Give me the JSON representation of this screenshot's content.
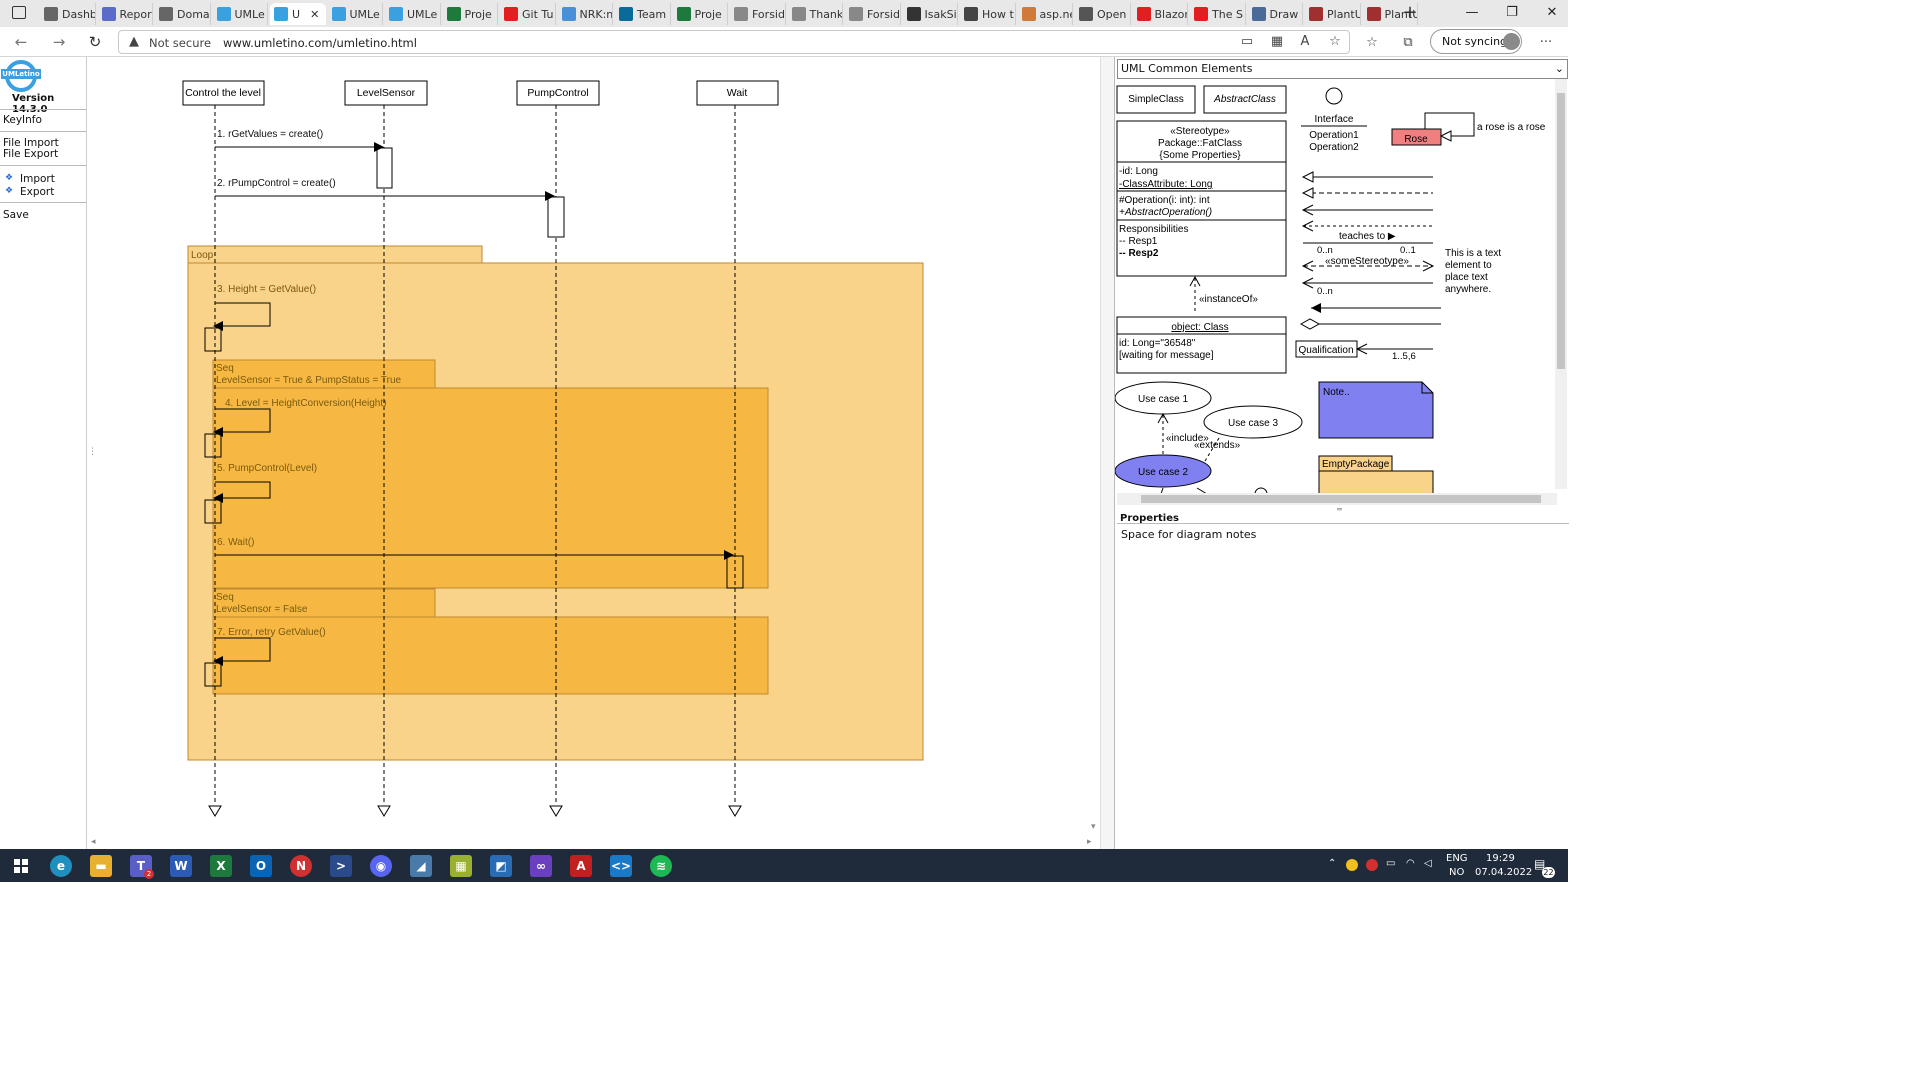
{
  "browser": {
    "tabs": [
      {
        "label": "Dashb",
        "color": "#666666",
        "icon": "document-icon"
      },
      {
        "label": "Repor",
        "color": "#5a6cc7",
        "icon": "report-icon"
      },
      {
        "label": "Doma",
        "color": "#666666",
        "icon": "document-icon"
      },
      {
        "label": "UMLe",
        "color": "#3aa0e0",
        "icon": "umletino-icon"
      },
      {
        "label": "U",
        "color": "#3aa0e0",
        "icon": "umletino-icon"
      },
      {
        "label": "UMLe",
        "color": "#3aa0e0",
        "icon": "umletino-icon"
      },
      {
        "label": "UMLe",
        "color": "#3aa0e0",
        "icon": "umletino-icon"
      },
      {
        "label": "Proje",
        "color": "#1e7a3c",
        "icon": "excel-icon"
      },
      {
        "label": "Git Tu",
        "color": "#e02020",
        "icon": "youtube-icon"
      },
      {
        "label": "NRK:n",
        "color": "#4a90d9",
        "icon": "nrk-icon"
      },
      {
        "label": "Team",
        "color": "#0a6a9a",
        "icon": "sharepoint-icon"
      },
      {
        "label": "Proje",
        "color": "#1e7a3c",
        "icon": "excel-icon"
      },
      {
        "label": "Forsid",
        "color": "#888888",
        "icon": "page-icon"
      },
      {
        "label": "Thank",
        "color": "#888888",
        "icon": "page-icon"
      },
      {
        "label": "Forsid",
        "color": "#888888",
        "icon": "page-icon"
      },
      {
        "label": "IsakSi",
        "color": "#333333",
        "icon": "github-icon"
      },
      {
        "label": "How t",
        "color": "#444444",
        "icon": "video-icon"
      },
      {
        "label": "asp.ne",
        "color": "#d07a3a",
        "icon": "page-icon"
      },
      {
        "label": "Open",
        "color": "#555555",
        "icon": "heart-icon"
      },
      {
        "label": "Blazor",
        "color": "#e02020",
        "icon": "youtube-icon"
      },
      {
        "label": "The S",
        "color": "#e02020",
        "icon": "youtube-icon"
      },
      {
        "label": "Draw",
        "color": "#4a6a9a",
        "icon": "draw-icon"
      },
      {
        "label": "PlantU",
        "color": "#a03030",
        "icon": "plantuml-icon"
      },
      {
        "label": "PlantU",
        "color": "#a03030",
        "icon": "plantuml-icon"
      }
    ],
    "security_label": "Not secure",
    "url": "www.umletino.com/umletino.html",
    "sync_label": "Not syncing"
  },
  "sidebar": {
    "logo_text": "UMLetino",
    "version": "Version 14.3.0",
    "keyinfo": "KeyInfo",
    "file_import": "File Import",
    "file_export": "File Export",
    "import": "Import",
    "export": "Export",
    "save": "Save"
  },
  "diagram": {
    "lifelines": [
      "Control the level",
      "LevelSensor",
      "PumpControl",
      "Wait"
    ],
    "messages": [
      "1. rGetValues = create()",
      "2. rPumpControl = create()",
      "3. Height = GetValue()",
      "4. Level = HeightConversion(Height)",
      "5. PumpControl(Level)",
      "6. Wait()",
      "7. Error, retry GetValue()"
    ],
    "loop_label": "Loop",
    "seq1_label": "Seq",
    "seq1_condition": "LevelSensor = True & PumpStatus = True",
    "seq2_label": "Seq",
    "seq2_condition": "LevelSensor = False"
  },
  "palette": {
    "selected": "UML Common Elements",
    "simple_class": "SimpleClass",
    "abstract_class": "AbstractClass",
    "interface_name": "Interface",
    "interface_ops": [
      "Operation1",
      "Operation2"
    ],
    "rose": "Rose",
    "rose_note": "a rose is a rose",
    "fat_stereotype": "«Stereotype»",
    "fat_package": "Package::FatClass",
    "fat_props": "{Some Properties}",
    "fat_attr1": "-id: Long",
    "fat_attr2": "-ClassAttribute: Long",
    "fat_op1": "#Operation(i: int): int",
    "fat_op2": "+AbstractOperation()",
    "fat_resp_title": "Responsibilities",
    "fat_resp1": "-- Resp1",
    "fat_resp2": "-- Resp2",
    "teaches": "teaches to ▶",
    "mult_left": "0..n",
    "mult_right": "0..1",
    "some_stereotype": "«someStereotype»",
    "mult_left2": "0..n",
    "text_element": [
      "This is a text",
      "element to",
      "place text",
      "anywhere."
    ],
    "instance_of": "«instanceOf»",
    "object_title": "object: Class",
    "object_attr1": "id: Long=\"36548\"",
    "object_attr2": "[waiting for message]",
    "qualification": "Qualification",
    "qual_mult": "1..5,6",
    "use_case1": "Use case 1",
    "use_case2": "Use case 2",
    "use_case3": "Use case 3",
    "include": "«include»",
    "extends": "«extends»",
    "note": "Note..",
    "empty_package": "EmptyPackage"
  },
  "properties": {
    "title": "Properties",
    "text": "Space for diagram notes"
  },
  "taskbar": {
    "lang1": "ENG",
    "lang2": "NO",
    "time": "19:29",
    "date": "07.04.2022",
    "teams_badge": "2",
    "notif_count": "22"
  },
  "colors": {
    "loop_fill": "#f9d38a",
    "seq_fill": "#f6b842",
    "frame_stroke": "#c08a30",
    "note_fill": "#8080f0",
    "rose_fill": "#f08080",
    "package_fill": "#f9d38a",
    "usecase2_fill": "#8080f0"
  }
}
